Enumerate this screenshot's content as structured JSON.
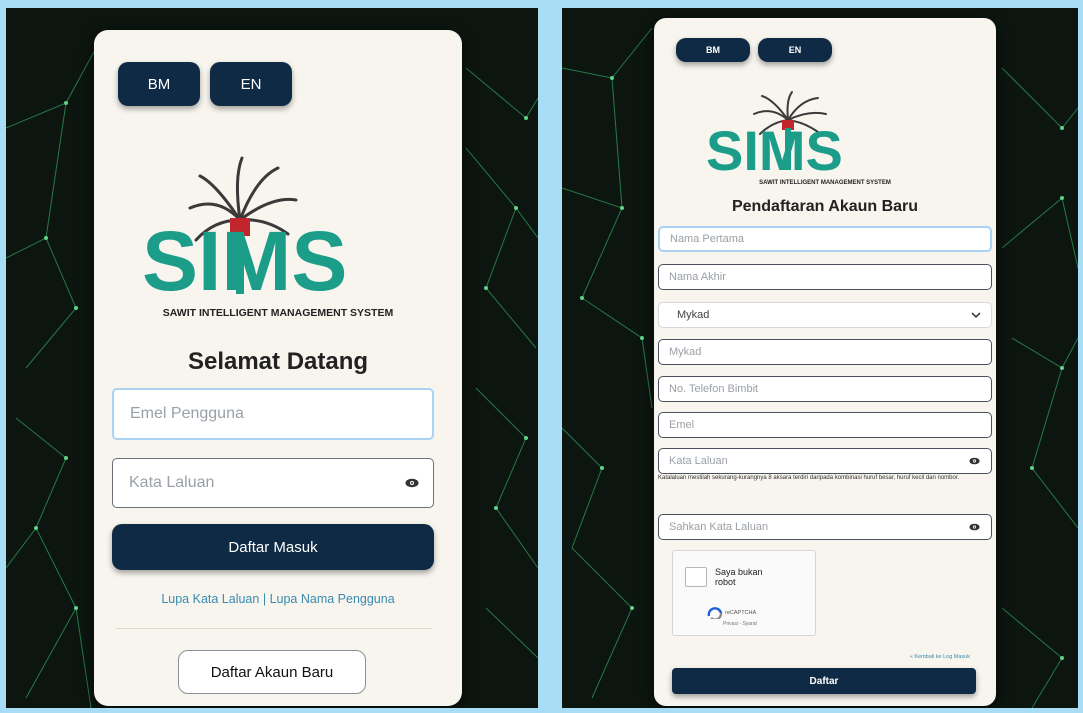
{
  "colors": {
    "navy": "#0f2a45",
    "teal": "#1b9d8a",
    "red": "#c0262b",
    "link": "#3a8bb0",
    "background": "#0c150f",
    "card": "#f8f4ee"
  },
  "login": {
    "lang_bm": "BM",
    "lang_en": "EN",
    "logo_text": "SIMS",
    "logo_tagline": "SAWIT INTELLIGENT MANAGEMENT SYSTEM",
    "title": "Selamat Datang",
    "email_placeholder": "Emel Pengguna",
    "password_placeholder": "Kata Laluan",
    "submit_label": "Daftar Masuk",
    "forgot_password": "Lupa Kata Laluan",
    "separator": "|",
    "forgot_username": "Lupa Nama Pengguna",
    "register_label": "Daftar Akaun Baru",
    "icons": {
      "password_toggle": "eye-icon",
      "logo": "palm-tree-icon"
    }
  },
  "register": {
    "lang_bm": "BM",
    "lang_en": "EN",
    "logo_text": "SIMS",
    "logo_tagline": "SAWIT INTELLIGENT MANAGEMENT SYSTEM",
    "title": "Pendaftaran Akaun Baru",
    "first_name_placeholder": "Nama Pertama",
    "last_name_placeholder": "Nama Akhir",
    "id_type_selected": "Mykad",
    "id_number_placeholder": "Mykad",
    "phone_placeholder": "No. Telefon Bimbit",
    "email_placeholder": "Emel",
    "password_placeholder": "Kata Laluan",
    "password_hint": "Katalaluan mestilah sekurang-kurangnya 8 aksara terdiri daripada kombinasi huruf besar, huruf kecil dan nombor.",
    "confirm_password_placeholder": "Sahkan Kata Laluan",
    "captcha_label": "Saya bukan robot",
    "captcha_brand": "reCAPTCHA",
    "captcha_terms": "Privasi - Syarat",
    "back_link": "« Kembali ke Log Masuk",
    "submit_label": "Daftar",
    "icons": {
      "password_toggle": "eye-icon",
      "select": "chevron-down-icon",
      "captcha": "recaptcha-icon"
    }
  }
}
